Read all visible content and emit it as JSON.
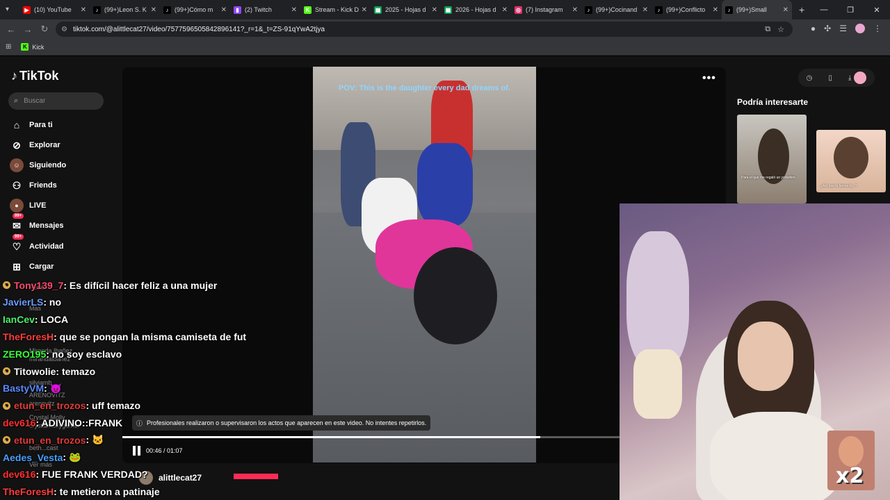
{
  "browser": {
    "tabs": [
      {
        "label": "(10) YouTube",
        "icon": "youtube-icon",
        "color": "#ff0000",
        "glyph": "▶"
      },
      {
        "label": "(99+)Leon S. K",
        "icon": "tiktok-icon",
        "color": "#000000",
        "glyph": "♪"
      },
      {
        "label": "(99+)Cómo m",
        "icon": "tiktok-icon",
        "color": "#000000",
        "glyph": "♪"
      },
      {
        "label": "(2) Twitch",
        "icon": "twitch-icon",
        "color": "#9146ff",
        "glyph": "▮"
      },
      {
        "label": "Stream - Kick D",
        "icon": "kick-icon",
        "color": "#53fc18",
        "glyph": "K"
      },
      {
        "label": "2025 - Hojas d",
        "icon": "sheets-icon",
        "color": "#0f9d58",
        "glyph": "▦"
      },
      {
        "label": "2026 - Hojas d",
        "icon": "sheets-icon",
        "color": "#0f9d58",
        "glyph": "▦"
      },
      {
        "label": "(7) Instagram",
        "icon": "instagram-icon",
        "color": "#e1306c",
        "glyph": "◎"
      },
      {
        "label": "(99+)Cocinand",
        "icon": "tiktok-icon",
        "color": "#000000",
        "glyph": "♪"
      },
      {
        "label": "(99+)Conflicto",
        "icon": "tiktok-icon",
        "color": "#000000",
        "glyph": "♪"
      },
      {
        "label": "(99+)Small",
        "icon": "tiktok-icon",
        "color": "#000000",
        "glyph": "♪",
        "active": true
      }
    ],
    "url": "tiktok.com/@alittlecat27/video/7577596505842896141?_r=1&_t=ZS-91qYwA2tjya",
    "bookmark": "Kick"
  },
  "sidebar": {
    "logo": "TikTok",
    "search_placeholder": "Buscar",
    "items": [
      {
        "label": "Para ti",
        "icon": "home-icon",
        "glyph": "⌂"
      },
      {
        "label": "Explorar",
        "icon": "compass-icon",
        "glyph": "⊘"
      },
      {
        "label": "Siguiendo",
        "icon": "following-avatar-icon",
        "glyph": "☺"
      },
      {
        "label": "Friends",
        "icon": "friends-icon",
        "glyph": "⚇"
      },
      {
        "label": "LIVE",
        "icon": "live-avatar-icon",
        "glyph": "●"
      },
      {
        "label": "Mensajes",
        "icon": "messages-icon",
        "glyph": "✉",
        "badge": "99+"
      },
      {
        "label": "Actividad",
        "icon": "activity-icon",
        "glyph": "♡",
        "badge": "99+"
      },
      {
        "label": "Cargar",
        "icon": "upload-icon",
        "glyph": "⊞"
      }
    ],
    "faded": [
      {
        "text": "Perfil"
      },
      {
        "text": "Más"
      },
      {
        "text": "Miranda Ibañez"
      },
      {
        "text": "mirandaibanez"
      },
      {
        "text": "silviamb"
      },
      {
        "text": "ARENOVITZ"
      },
      {
        "text": "arenovitz"
      },
      {
        "text": "Crystal Molly"
      },
      {
        "text": "crystalmollygamer"
      },
      {
        "text": "beth...cast"
      },
      {
        "text": "Ver más"
      }
    ]
  },
  "video": {
    "caption": "POV: This is the daughter every dad dreams of.",
    "disclaimer": "Profesionales realizaron o supervisaron los actos que aparecen en este video. No intentes repetirlos.",
    "time": "00:46 / 01:07",
    "progress": 0.84,
    "author": "alittlecat27"
  },
  "right": {
    "recommend_title": "Podría interesarte",
    "thumb1_text": "Para el que me regaló un yorkshire",
    "thumb2_text": "¿Así que lo tienes tú...?"
  },
  "overlay": {
    "x2": "x2"
  },
  "chat": [
    {
      "user": "Tony139_7",
      "msg": ": Es difícil hacer feliz a una mujer",
      "color": "#ff4a6e",
      "badge": true
    },
    {
      "user": "JavierLS",
      "msg": ": no",
      "color": "#6c9bff",
      "badge": false
    },
    {
      "user": "IanCev",
      "msg": ": LOCA",
      "color": "#4ef06b",
      "badge": false
    },
    {
      "user": "TheForesH",
      "msg": ": que se pongan la misma camiseta de fut",
      "color": "#ff3d3d",
      "badge": false
    },
    {
      "user": "ZERO195",
      "msg": ": no soy esclavo",
      "color": "#39ff3a",
      "badge": false
    },
    {
      "user": "Titowolie",
      "msg": ": temazo",
      "color": "#ffffff",
      "badge": true
    },
    {
      "user": "BastyVM",
      "msg": ": 😈",
      "color": "#5a8cff",
      "badge": false
    },
    {
      "user": "etun_en_trozos",
      "msg": ": uff temazo",
      "color": "#e23a3a",
      "badge": true
    },
    {
      "user": "dev616",
      "msg": ": ADIVINO::FRANK",
      "color": "#ff3030",
      "badge": false
    },
    {
      "user": "etun_en_trozos",
      "msg": ": 🐱",
      "color": "#e23a3a",
      "badge": true
    },
    {
      "user": "Aedes_Vesta",
      "msg": ": 🐸",
      "color": "#4aa0ff",
      "badge": false
    },
    {
      "user": "dev616",
      "msg": ": FUE FRANK VERDAD?",
      "color": "#ff3030",
      "badge": false
    },
    {
      "user": "TheForesH",
      "msg": ": te metieron a patinaje",
      "color": "#ff3d3d",
      "badge": false
    }
  ]
}
